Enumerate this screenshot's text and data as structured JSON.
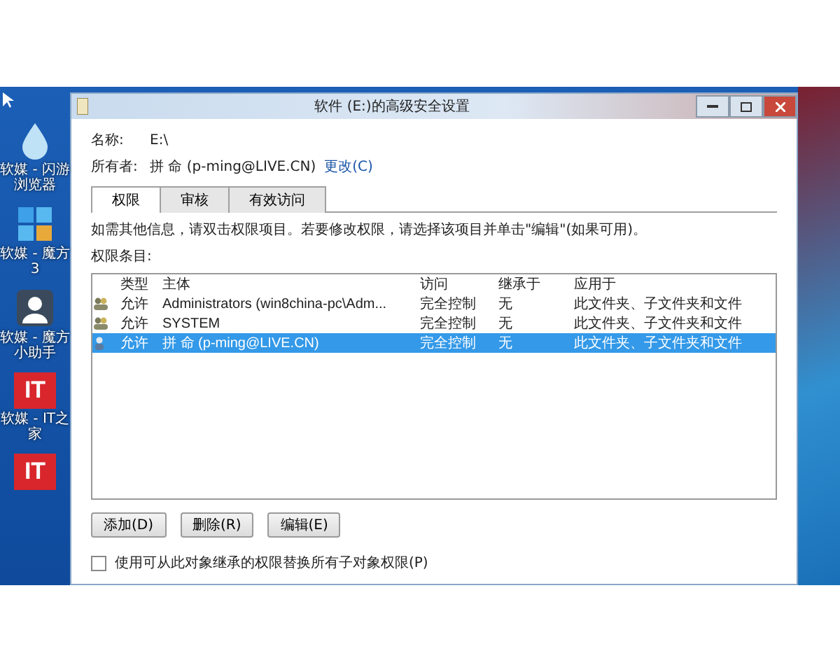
{
  "desktop_icons": [
    {
      "kind": "droplet",
      "label": "软媒 - 闪游浏览器"
    },
    {
      "kind": "tiles",
      "label": "软媒 - 魔方3"
    },
    {
      "kind": "person",
      "label": "软媒 - 魔方小助手"
    },
    {
      "kind": "logo",
      "logo_text": "IT",
      "label": "软媒 - IT之家"
    },
    {
      "kind": "logo",
      "logo_text": "IT"
    }
  ],
  "window": {
    "title": "软件 (E:)的高级安全设置"
  },
  "fields": [
    {
      "label": "名称:",
      "value": "E:\\"
    },
    {
      "label": "所有者:",
      "value": "拼 命 (p-ming@LIVE.CN)",
      "link": "更改(C)"
    }
  ],
  "tabs": [
    {
      "label": "权限",
      "selected": true
    },
    {
      "label": "审核",
      "selected": false
    },
    {
      "label": "有效访问",
      "selected": false
    }
  ],
  "info_text": "如需其他信息，请双击权限项目。若要修改权限，请选择该项目并单击\"编辑\"(如果可用)。",
  "list_label": "权限条目:",
  "table": {
    "columns": [
      "类型",
      "主体",
      "访问",
      "继承于",
      "应用于"
    ],
    "rows": [
      {
        "kind": "group",
        "selected": false,
        "cells": [
          "允许",
          "Administrators (win8china-pc\\Adm...",
          "完全控制",
          "无",
          "此文件夹、子文件夹和文件"
        ]
      },
      {
        "kind": "group",
        "selected": false,
        "cells": [
          "允许",
          "SYSTEM",
          "完全控制",
          "无",
          "此文件夹、子文件夹和文件"
        ]
      },
      {
        "kind": "user",
        "selected": true,
        "cells": [
          "允许",
          "拼 命 (p-ming@LIVE.CN)",
          "完全控制",
          "无",
          "此文件夹、子文件夹和文件"
        ]
      }
    ]
  },
  "buttons": [
    "添加(D)",
    "删除(R)",
    "编辑(E)"
  ],
  "replace_option": {
    "label": "使用可从此对象继承的权限替换所有子对象权限(P)",
    "checked": false
  }
}
